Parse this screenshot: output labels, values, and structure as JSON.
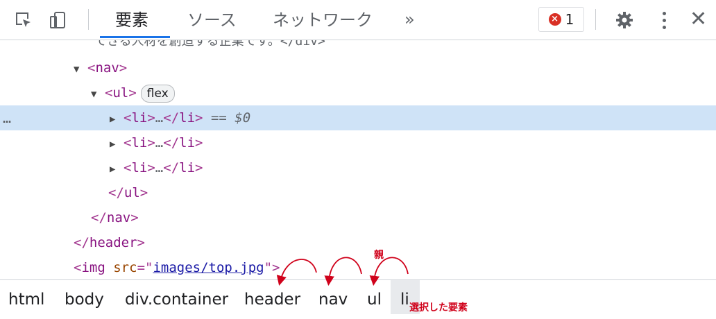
{
  "toolbar": {
    "tabs": [
      {
        "label": "要素",
        "active": true
      },
      {
        "label": "ソース",
        "active": false
      },
      {
        "label": "ネットワーク",
        "active": false
      }
    ],
    "more_tabs": "»",
    "error_count": "1",
    "icons": [
      "inspect-icon",
      "device-toggle-icon",
      "gear-icon",
      "kebab-menu-icon",
      "close-icon"
    ]
  },
  "tree": {
    "cut_text": "できる人材を創造する企業です。</div>",
    "nav_open": "nav",
    "ul_open": "ul",
    "flex_badge": "flex",
    "li": "li",
    "ellipsis": "…",
    "dollar": "== $0",
    "gutter": "…",
    "ul_close": "ul",
    "nav_close": "nav",
    "header_close": "header",
    "img_tag": "img",
    "img_attr": "src",
    "img_src": "images/top.jpg"
  },
  "breadcrumbs": [
    "html",
    "body",
    "div.container",
    "header",
    "nav",
    "ul",
    "li"
  ],
  "annotations": {
    "parent": "親",
    "selected": "選択した要素"
  },
  "colors": {
    "accent": "#1a73e8",
    "selected_row": "#cfe3f7",
    "tag": "#881280",
    "annotation": "#d0021b",
    "error": "#d93025"
  }
}
